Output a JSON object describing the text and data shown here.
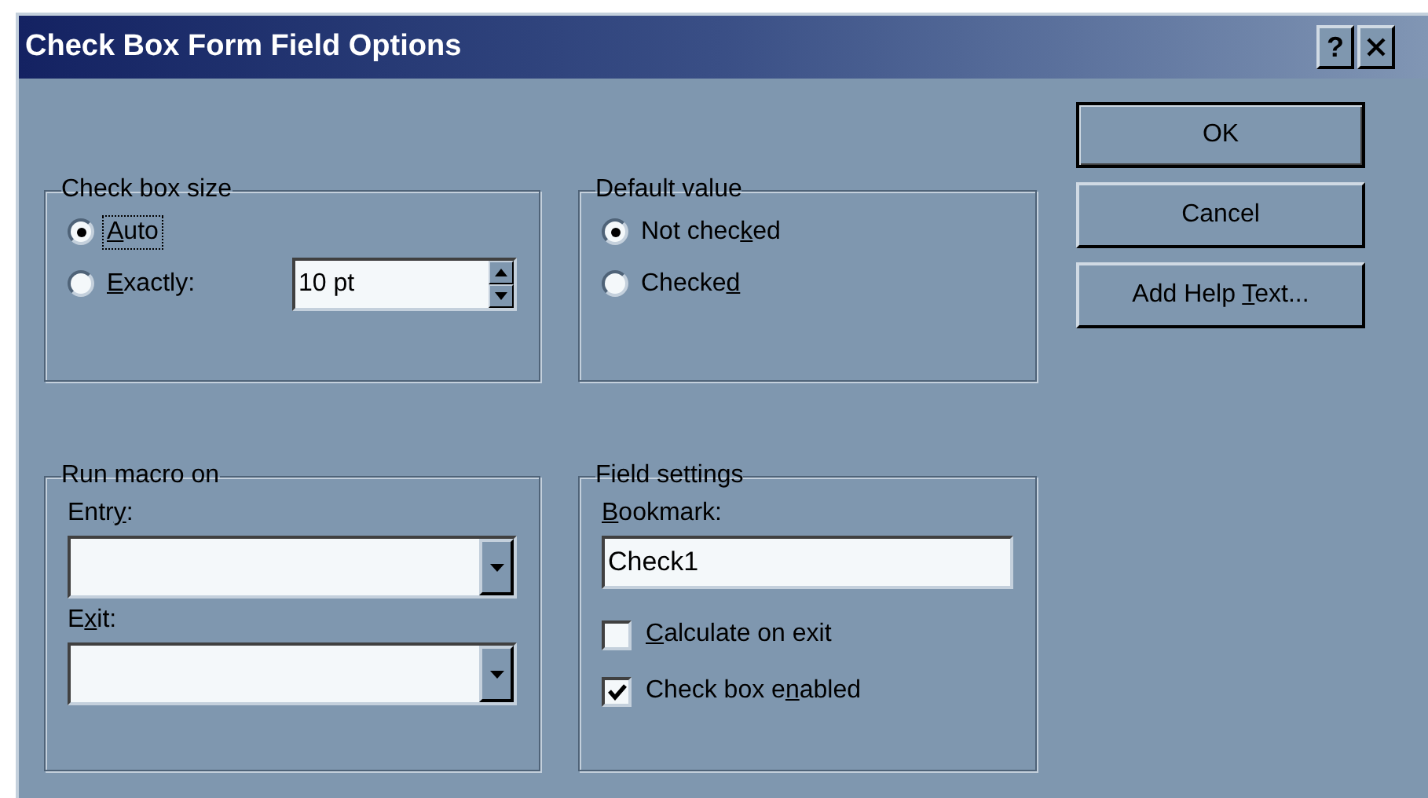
{
  "window": {
    "title": "Check Box Form Field Options",
    "help_button": "?"
  },
  "check_box_size": {
    "title": "Check box size",
    "options": [
      {
        "label": {
          "key": "A",
          "after": "uto"
        },
        "selected": true,
        "focused": true
      },
      {
        "label": {
          "key": "E",
          "after": "xactly:"
        },
        "selected": false,
        "focused": false
      }
    ],
    "size_field": {
      "value": "10 pt"
    }
  },
  "default_value": {
    "title": "Default value",
    "options": [
      {
        "label": {
          "before": "Not chec",
          "key": "k",
          "after": "ed"
        },
        "selected": true,
        "focused": false
      },
      {
        "label": {
          "before": "Checke",
          "key": "d"
        },
        "selected": false,
        "focused": false
      }
    ]
  },
  "run_macro_on": {
    "title": "Run macro on",
    "fields": [
      {
        "label": {
          "before": "Entr",
          "key": "y",
          "after": ":"
        }
      },
      {
        "label": {
          "before": "E",
          "key": "x",
          "after": "it:"
        }
      }
    ]
  },
  "field_settings": {
    "title": "Field settings",
    "bookmark": {
      "label": {
        "key": "B",
        "after": "ookmark:"
      },
      "value": "Check1"
    },
    "checkboxes": [
      {
        "label": {
          "key": "C",
          "after": "alculate on exit"
        },
        "checked": false
      },
      {
        "label": {
          "before": "Check box e",
          "key": "n",
          "after": "abled"
        },
        "checked": true
      }
    ]
  },
  "buttons": [
    {
      "label": {
        "before": "OK"
      },
      "default": true
    },
    {
      "label": {
        "before": "Cancel"
      },
      "default": false
    },
    {
      "label": {
        "before": "Add Help ",
        "key": "T",
        "after": "ext..."
      },
      "default": false
    }
  ]
}
